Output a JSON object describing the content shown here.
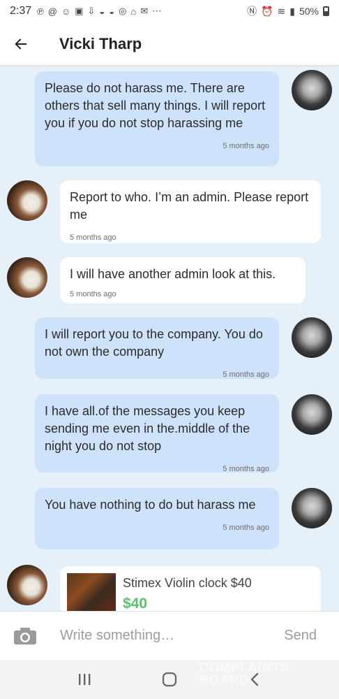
{
  "status_bar": {
    "time": "2:37",
    "battery": "50%",
    "icons": [
      "pinterest-icon",
      "threads-icon",
      "snapchat-icon",
      "cnn-icon",
      "download-icon",
      "bowl-icon",
      "bowl-icon",
      "instagram-icon",
      "home-icon",
      "mail-icon",
      "more-icon",
      "nfc-icon",
      "alarm-icon",
      "wifi-icon",
      "signal-icon",
      "battery-icon"
    ]
  },
  "header": {
    "title": "Vicki Tharp"
  },
  "messages": [
    {
      "side": "out",
      "text": "Please do not harass me. There are others that sell many things. I will report you if you do not stop harassing me",
      "time": "5 months ago"
    },
    {
      "side": "in",
      "text": "Report to who. I’m an admin. Please report me",
      "time": "5 months ago"
    },
    {
      "side": "in",
      "text": "I will have another admin look at this.",
      "time": "5 months ago"
    },
    {
      "side": "out",
      "text": "I will report you to the company. You do not own the company",
      "time": "5 months ago"
    },
    {
      "side": "out",
      "text": "I have all.of the messages you keep sending me even in the.middle of the night you do not stop",
      "time": "5 months ago"
    },
    {
      "side": "out",
      "text": "You have nothing to do but harass me",
      "time": "5 months ago"
    }
  ],
  "product": {
    "title": "Stimex Violin clock $40",
    "price": "$40"
  },
  "composer": {
    "placeholder": "Write something…",
    "send_label": "Send"
  },
  "watermark": "COMPLAINTS BOARD",
  "colors": {
    "outgoing_bubble": "#cfe2fb",
    "incoming_bubble": "#ffffff",
    "background": "#e6f0f9",
    "price": "#5ac26a"
  }
}
